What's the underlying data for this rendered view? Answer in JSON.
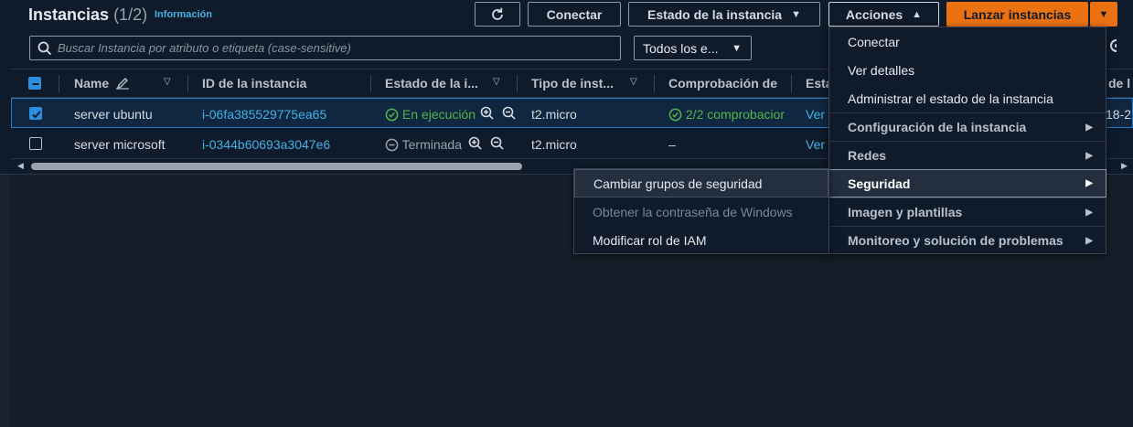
{
  "header": {
    "title": "Instancias",
    "count": "(1/2)",
    "info_link": "Información"
  },
  "toolbar": {
    "connect_label": "Conectar",
    "instance_state_label": "Estado de la instancia",
    "actions_label": "Acciones",
    "launch_label": "Lanzar instancias"
  },
  "search": {
    "placeholder": "Buscar Instancia por atributo o etiqueta (case-sensitive)",
    "filter_value": "Todos los e..."
  },
  "table": {
    "columns": [
      "Name",
      "ID de la instancia",
      "Estado de la i...",
      "Tipo de inst...",
      "Comprobación de",
      "Esta",
      "de l"
    ],
    "rows": [
      {
        "name": "server ubuntu",
        "id": "i-06fa385529775ea65",
        "state": "En ejecución",
        "type": "t2.micro",
        "check": "2/2 comprobacior",
        "alarm": "Ver",
        "extra": "18-2",
        "selected": true
      },
      {
        "name": "server microsoft",
        "id": "i-0344b60693a3047e6",
        "state": "Terminada",
        "type": "t2.micro",
        "check": "–",
        "alarm": "Ver",
        "extra": "",
        "selected": false
      }
    ]
  },
  "actions_menu": {
    "items": [
      "Conectar",
      "Ver detalles",
      "Administrar el estado de la instancia"
    ],
    "groups": [
      "Configuración de la instancia",
      "Redes",
      "Seguridad",
      "Imagen y plantillas",
      "Monitoreo y solución de problemas"
    ]
  },
  "security_submenu": {
    "items": [
      "Cambiar grupos de seguridad",
      "Obtener la contraseña de Windows",
      "Modificar rol de IAM"
    ]
  },
  "colors": {
    "background": "#0f1b2a",
    "accent": "#ec7211",
    "link": "#43b0e4",
    "success": "#55b34a"
  }
}
